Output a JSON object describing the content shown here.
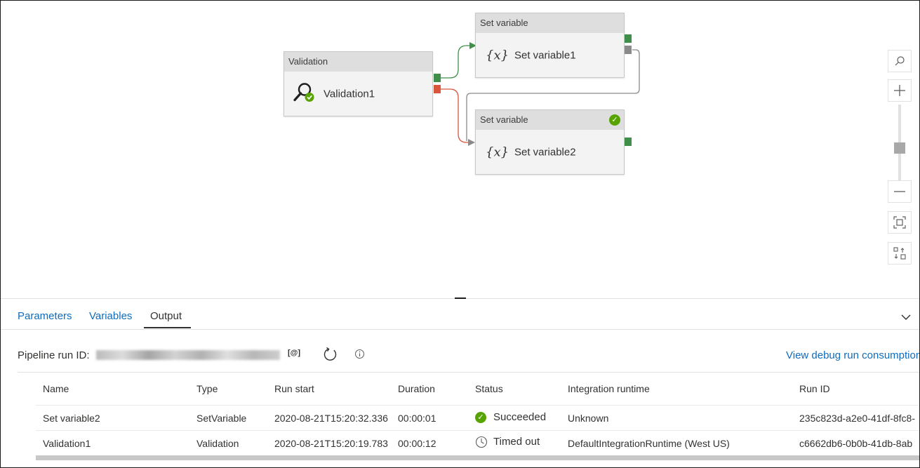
{
  "canvas": {
    "activities": [
      {
        "id": "validation",
        "header": "Validation",
        "label": "Validation1",
        "icon": "magnifier-check-icon"
      },
      {
        "id": "setvar1",
        "header": "Set variable",
        "label": "Set variable1",
        "icon": "fx-icon"
      },
      {
        "id": "setvar2",
        "header": "Set variable",
        "label": "Set variable2",
        "icon": "fx-icon",
        "status": "succeeded"
      }
    ],
    "fx_glyph": "{𝑥}"
  },
  "zoom_toolbar": [
    "search-icon",
    "zoom-in-icon",
    "zoom-slider",
    "zoom-out-icon",
    "fit-to-screen-icon",
    "auto-align-icon"
  ],
  "tabs": [
    {
      "label": "Parameters",
      "active": false
    },
    {
      "label": "Variables",
      "active": false
    },
    {
      "label": "Output",
      "active": true
    }
  ],
  "run": {
    "label": "Pipeline run ID:",
    "copy_label": "[@]",
    "debug_link": "View debug run consumption"
  },
  "table": {
    "columns": [
      "Name",
      "Type",
      "Run start",
      "Duration",
      "Status",
      "Integration runtime",
      "Run ID"
    ],
    "rows": [
      {
        "name": "Set variable2",
        "type": "SetVariable",
        "run_start": "2020-08-21T15:20:32.336",
        "duration": "00:00:01",
        "status": "Succeeded",
        "runtime": "Unknown",
        "run_id": "235c823d-a2e0-41df-8fc8-"
      },
      {
        "name": "Validation1",
        "type": "Validation",
        "run_start": "2020-08-21T15:20:19.783",
        "duration": "00:00:12",
        "status": "Timed out",
        "runtime": "DefaultIntegrationRuntime (West US)",
        "run_id": "c6662db6-0b0b-41db-8ab"
      }
    ]
  },
  "colors": {
    "accent": "#0f6cbd",
    "success": "#57a300",
    "failure": "#d9563d",
    "port_success": "#3f8f4a",
    "port_completion": "#8a8a8a"
  }
}
